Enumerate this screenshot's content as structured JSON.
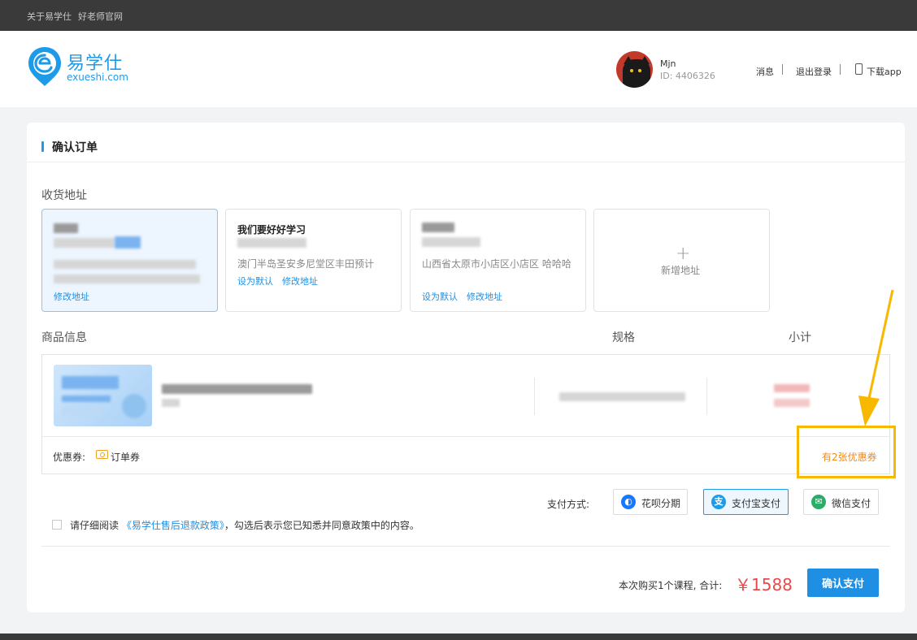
{
  "topbar": {
    "link_about": "关于易学仕",
    "link_official": "好老师官网"
  },
  "header": {
    "logo_cn": "易学仕",
    "logo_en": "exueshi.com",
    "user_name": "Mjn",
    "user_id": "ID: 4406326",
    "messages": "消息",
    "logout": "退出登录",
    "download": "下载app"
  },
  "page": {
    "title": "确认订单"
  },
  "address": {
    "section_label": "收货地址",
    "cards": [
      {
        "name": "",
        "detail": "",
        "link_edit": "修改地址",
        "selected": true
      },
      {
        "name": "我们要好好学习",
        "detail": "澳门半岛圣安多尼堂区丰田预计",
        "link_default": "设为默认",
        "link_edit": "修改地址"
      },
      {
        "name": "",
        "detail": "山西省太原市小店区小店区 哈哈哈",
        "link_default": "设为默认",
        "link_edit": "修改地址"
      }
    ],
    "add_label": "新增地址"
  },
  "goods": {
    "label_info": "商品信息",
    "label_spec": "规格",
    "label_subtotal": "小计",
    "coupon_label": "优惠券:",
    "coupon_type": "订单券",
    "coupon_count": "有2张优惠券"
  },
  "payment": {
    "label": "支付方式:",
    "options": [
      {
        "label": "花呗分期",
        "icon": "huabei-icon",
        "color": "#1677ff"
      },
      {
        "label": "支付宝支付",
        "icon": "alipay-icon",
        "color": "#1e9be8"
      },
      {
        "label": "微信支付",
        "icon": "wechat-icon",
        "color": "#2aae67"
      }
    ]
  },
  "agreement": {
    "prefix": "请仔细阅读",
    "policy": "《易学仕售后退款政策》",
    "suffix": "，勾选后表示您已知悉并同意政策中的内容。"
  },
  "summary": {
    "label": "本次购买1个课程, 合计:",
    "price": "￥1588",
    "confirm": "确认支付"
  },
  "colors": {
    "accent": "#1e9be8",
    "price": "#e84a4a",
    "coupon": "#f08a1d",
    "highlight": "#f9b800"
  }
}
